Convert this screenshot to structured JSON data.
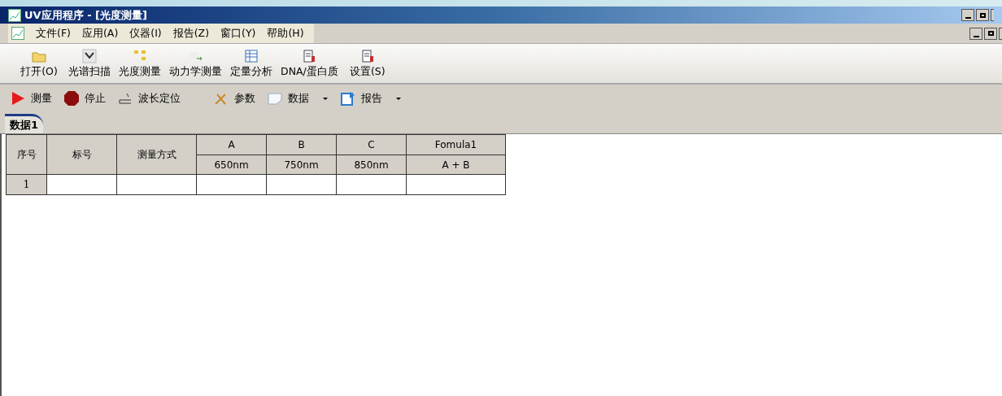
{
  "window": {
    "title": "UV应用程序 - [光度测量]"
  },
  "menu": [
    "文件(F)",
    "应用(A)",
    "仪器(I)",
    "报告(Z)",
    "窗口(Y)",
    "帮助(H)"
  ],
  "toolbar": [
    {
      "label": "打开(O)",
      "kind": "folder"
    },
    {
      "label": "光谱扫描",
      "kind": "scan"
    },
    {
      "label": "光度测量",
      "kind": "photo"
    },
    {
      "label": "动力学测量",
      "kind": "kinetic"
    },
    {
      "label": "定量分析",
      "kind": "quant"
    },
    {
      "label": "DNA/蛋白质",
      "kind": "dna"
    },
    {
      "label": "设置(S)",
      "kind": "settings"
    }
  ],
  "actions": [
    {
      "label": "测量",
      "kind": "play",
      "dropdown": false
    },
    {
      "label": "停止",
      "kind": "stop",
      "dropdown": false
    },
    {
      "label": "波长定位",
      "kind": "wave",
      "dropdown": false
    },
    {
      "label": "参数",
      "kind": "tools",
      "dropdown": false
    },
    {
      "label": "数据",
      "kind": "data",
      "dropdown": true
    },
    {
      "label": "报告",
      "kind": "report",
      "dropdown": true
    }
  ],
  "tabs": [
    {
      "label": "数据1",
      "selected": true
    }
  ],
  "table": {
    "fixed_columns": [
      "序号",
      "标号",
      "测量方式"
    ],
    "wave_columns": [
      {
        "name": "A",
        "sub": "650nm"
      },
      {
        "name": "B",
        "sub": "750nm"
      },
      {
        "name": "C",
        "sub": "850nm"
      },
      {
        "name": "Fomula1",
        "sub": "A + B"
      }
    ],
    "rows": [
      {
        "index": "1"
      }
    ]
  }
}
